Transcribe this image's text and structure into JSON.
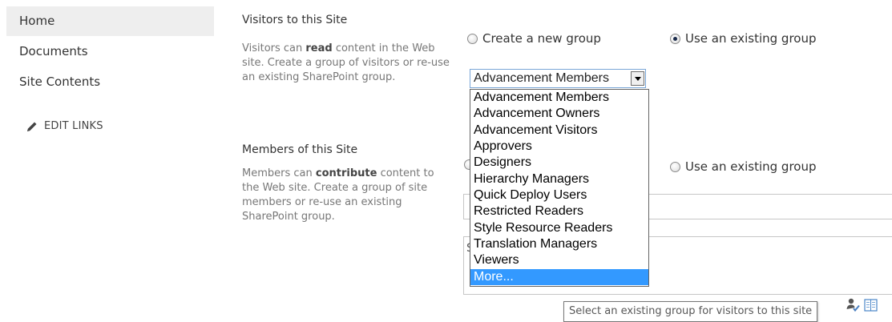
{
  "nav": {
    "items": [
      {
        "label": "Home"
      },
      {
        "label": "Documents"
      },
      {
        "label": "Site Contents"
      }
    ],
    "edit_links_label": "EDIT LINKS",
    "edit_icon": "pencil-icon"
  },
  "visitors": {
    "title": "Visitors to this Site",
    "desc_before": "Visitors can ",
    "desc_bold": "read",
    "desc_after": " content in the Web site. Create a group of visitors or re-use an existing SharePoint group.",
    "radio_new_label": "Create a new group",
    "radio_existing_label": "Use an existing group",
    "selected_option": "existing",
    "select_value": "Advancement Members",
    "options": [
      "Advancement Members",
      "Advancement Owners",
      "Advancement Visitors",
      "Approvers",
      "Designers",
      "Hierarchy Managers",
      "Quick Deploy Users",
      "Restricted Readers",
      "Style Resource Readers",
      "Translation Managers",
      "Viewers",
      "More..."
    ],
    "highlighted_option": "More...",
    "tooltip": "Select an existing group for visitors to this site"
  },
  "members": {
    "title": "Members of this Site",
    "desc_before": "Members can ",
    "desc_bold": "contribute",
    "desc_after": " content to the Web site. Create a group of site members or re-use an existing SharePoint group.",
    "radio_existing_label": "Use an existing group",
    "partial_text": "S"
  },
  "icons": {
    "people_picker": "check-names-icon",
    "address_book": "address-book-icon"
  },
  "colors": {
    "highlight": "#3399ff",
    "select_border": "#7aa7d8",
    "nav_selected_bg": "#eeeeee"
  }
}
